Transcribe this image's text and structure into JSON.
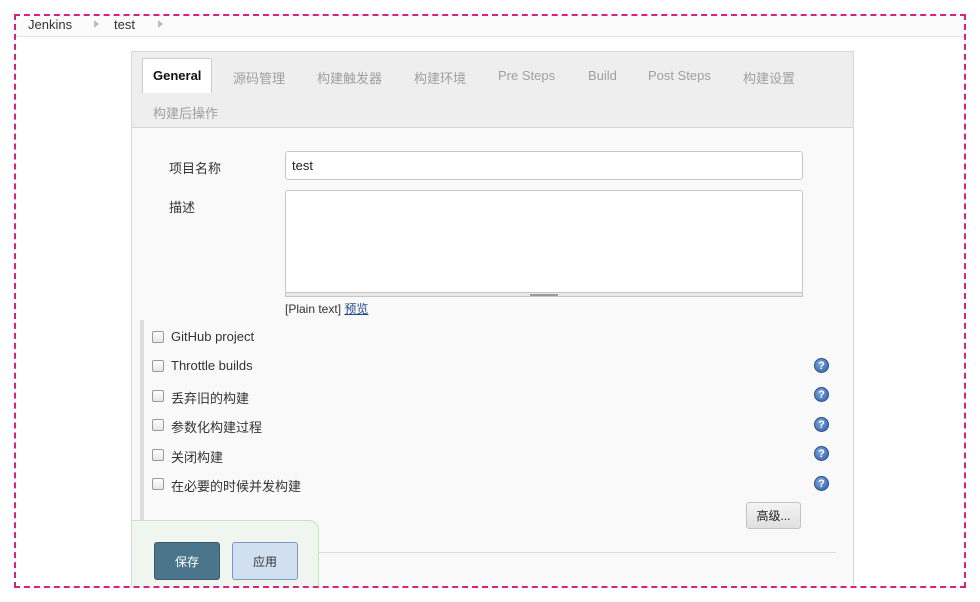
{
  "breadcrumb": {
    "items": [
      "Jenkins",
      "test"
    ]
  },
  "tabs": [
    {
      "label": "General",
      "active": true
    },
    {
      "label": "源码管理"
    },
    {
      "label": "构建触发器"
    },
    {
      "label": "构建环境"
    },
    {
      "label": "Pre Steps"
    },
    {
      "label": "Build"
    },
    {
      "label": "Post Steps"
    },
    {
      "label": "构建设置"
    },
    {
      "label": "构建后操作"
    }
  ],
  "general": {
    "project_name_label": "项目名称",
    "project_name_value": "test",
    "description_label": "描述",
    "description_value": "",
    "plain_text": "[Plain text]",
    "preview_link": "预览"
  },
  "options": [
    {
      "label": "GitHub project",
      "checked": false,
      "help": false
    },
    {
      "label": "Throttle builds",
      "checked": false,
      "help": true
    },
    {
      "label": "丢弃旧的构建",
      "checked": false,
      "help": true
    },
    {
      "label": "参数化构建过程",
      "checked": false,
      "help": true
    },
    {
      "label": "关闭构建",
      "checked": false,
      "help": true
    },
    {
      "label": "在必要的时候并发构建",
      "checked": false,
      "help": true
    }
  ],
  "help_icon_glyph": "?",
  "advanced_button": "高级...",
  "save_button": "保存",
  "apply_button": "应用",
  "colors": {
    "frame_border": "#d6247e",
    "save_bg": "#4b758b",
    "apply_bg": "#d1e0f0"
  }
}
